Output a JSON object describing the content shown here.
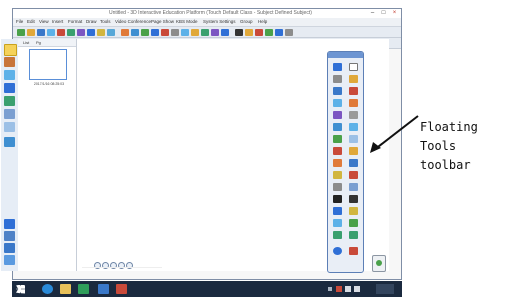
{
  "window": {
    "title": "Untitled - 3D Interactive Education Platform (Touch Default Class - Subject Defined Subject)",
    "controls": [
      "–",
      "□",
      "×"
    ]
  },
  "menu": {
    "items": [
      "File",
      "Edit",
      "View",
      "Insert",
      "Format",
      "Draw",
      "Tools",
      "Video Conference",
      "Page Show",
      "KBS Mode",
      "System Settings",
      "Group",
      "Help"
    ]
  },
  "thumbnails": {
    "tabs": [
      "List",
      "Pg"
    ],
    "page_caption": "2017/1/16 08:25:03"
  },
  "callout": {
    "line1": "Floating",
    "line2": "Tools toolbar"
  },
  "colors": {
    "window_border": "#7f8ea6",
    "floating_border": "#5c7fb6",
    "taskbar": "#1b2a3f",
    "accent_blue": "#2f6fd6"
  }
}
